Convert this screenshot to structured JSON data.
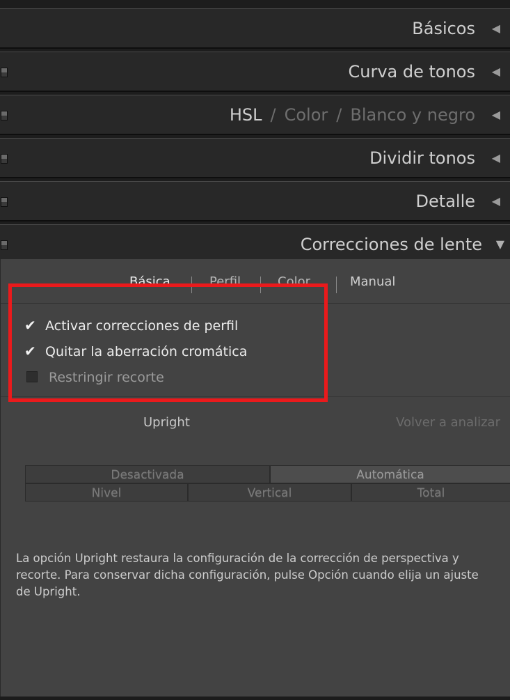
{
  "panels": [
    {
      "label": "Básicos",
      "arrow": "◀"
    },
    {
      "label": "Curva de tonos",
      "arrow": "◀"
    },
    {
      "hsl": "HSL",
      "sep": "/",
      "color": "Color",
      "bw": "Blanco y negro",
      "arrow": "◀"
    },
    {
      "label": "Dividir tonos",
      "arrow": "◀"
    },
    {
      "label": "Detalle",
      "arrow": "◀"
    },
    {
      "label": "Correcciones de lente",
      "arrow": "▼"
    }
  ],
  "lens": {
    "tabs": [
      "Básica",
      "Perfil",
      "Color",
      "Manual"
    ],
    "active_tab": "Básica",
    "checks": [
      {
        "label": "Activar correcciones de perfil",
        "checked": true
      },
      {
        "label": "Quitar la aberración cromática",
        "checked": true
      },
      {
        "label": "Restringir recorte",
        "checked": false
      }
    ],
    "upright_label": "Upright",
    "reanalyze": "Volver a analizar",
    "upright_row1": [
      "Desactivada",
      "Automática"
    ],
    "upright_row2": [
      "Nivel",
      "Vertical",
      "Total"
    ],
    "help_text": "La opción Upright restaura la configuración de la corrección de perspectiva y recorte. Para conservar dicha configuración, pulse Opción cuando elija un ajuste de Upright."
  },
  "colors": {
    "highlight": "#ea1a1c",
    "panel_bg": "#434343",
    "header_bg": "#282828"
  },
  "icons": {
    "check": "check-mark-icon",
    "collapsed": "triangle-left-icon",
    "expanded": "triangle-down-icon",
    "switch": "panel-switch-icon"
  }
}
